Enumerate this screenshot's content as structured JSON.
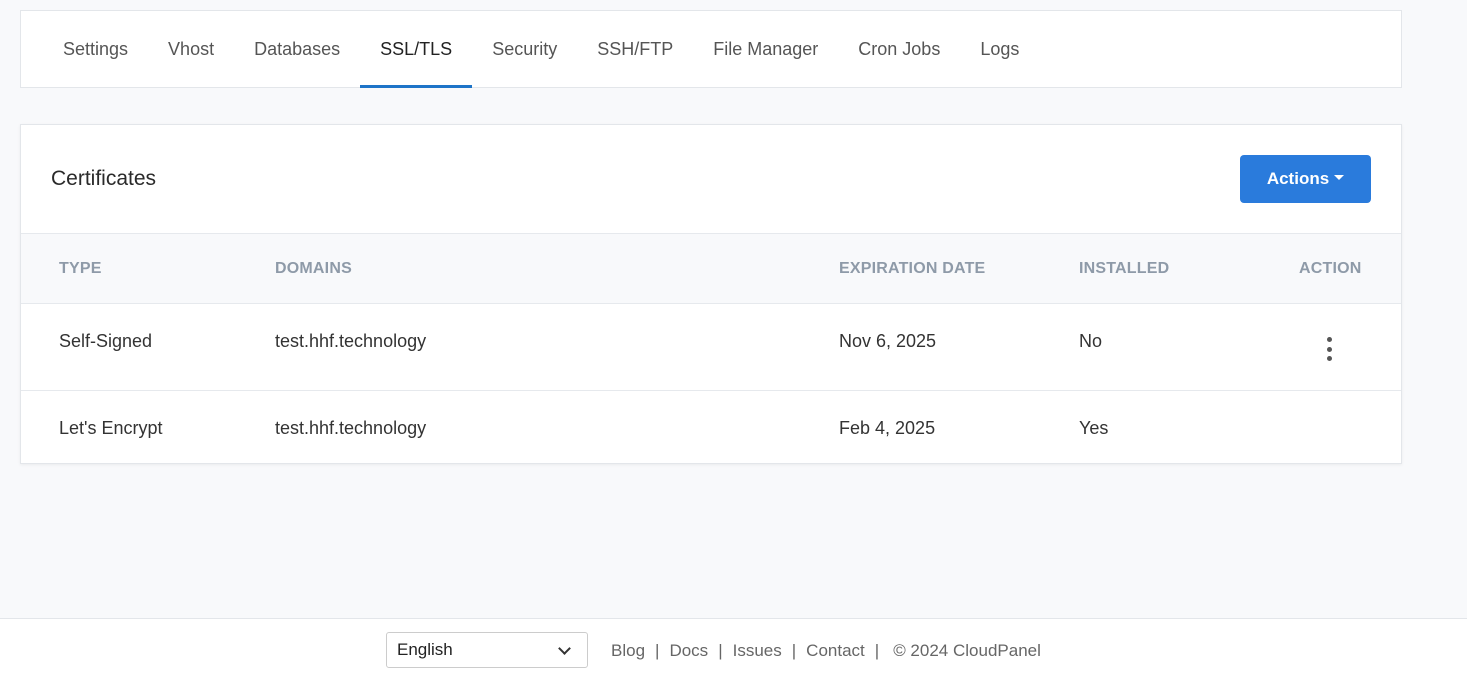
{
  "tabs": [
    {
      "label": "Settings"
    },
    {
      "label": "Vhost"
    },
    {
      "label": "Databases"
    },
    {
      "label": "SSL/TLS",
      "active": true
    },
    {
      "label": "Security"
    },
    {
      "label": "SSH/FTP"
    },
    {
      "label": "File Manager"
    },
    {
      "label": "Cron Jobs"
    },
    {
      "label": "Logs"
    }
  ],
  "certificates": {
    "title": "Certificates",
    "actions_label": "Actions",
    "columns": {
      "type": "TYPE",
      "domains": "DOMAINS",
      "expiration": "EXPIRATION DATE",
      "installed": "INSTALLED",
      "action": "ACTION"
    },
    "rows": [
      {
        "type": "Self-Signed",
        "domains": "test.hhf.technology",
        "expiration": "Nov 6, 2025",
        "installed": "No"
      },
      {
        "type": "Let's Encrypt",
        "domains": "test.hhf.technology",
        "expiration": "Feb 4, 2025",
        "installed": "Yes"
      }
    ]
  },
  "footer": {
    "language": "English",
    "links": {
      "blog": "Blog",
      "docs": "Docs",
      "issues": "Issues",
      "contact": "Contact"
    },
    "separator": "|",
    "copyright": "© 2024  CloudPanel"
  },
  "colors": {
    "accent": "#2a7bdc",
    "active_tab_underline": "#1d74c8"
  }
}
